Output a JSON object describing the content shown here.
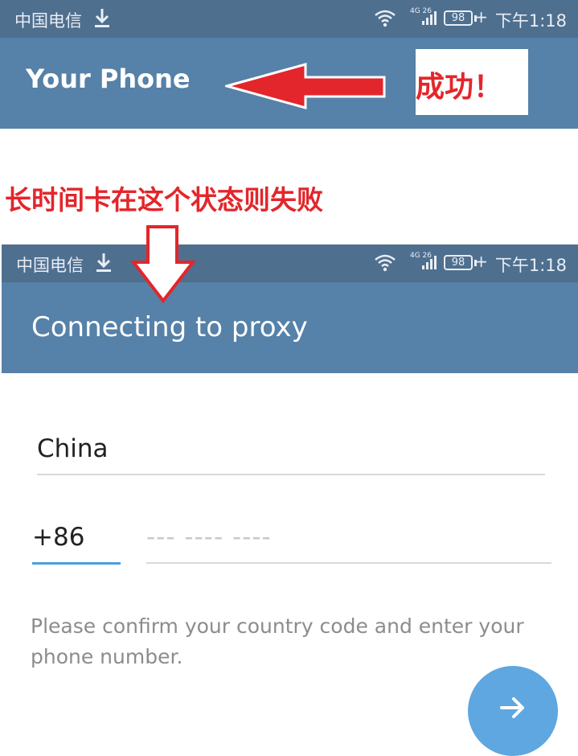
{
  "top_screen": {
    "status_bar": {
      "carrier": "中国电信",
      "network": "4G 26",
      "battery": "98",
      "time": "下午1:18"
    },
    "title": "Your Phone"
  },
  "annotations": {
    "success": "成功！",
    "failure": "长时间卡在这个状态则失败",
    "arrow_color": "#e3262b"
  },
  "bottom_screen": {
    "status_bar": {
      "carrier": "中国电信",
      "network": "4G 26",
      "battery": "98",
      "time": "下午1:18"
    },
    "title": "Connecting to proxy",
    "country": "China",
    "country_code": "+86",
    "phone_placeholder": "--- ---- ----",
    "hint": "Please confirm your country code and enter your phone number.",
    "next_button_icon": "arrow-right-icon"
  },
  "colors": {
    "status_bar": "#4f6f8f",
    "app_bar": "#5681a8",
    "accent": "#4a9fe0",
    "fab": "#5ea7e0"
  }
}
